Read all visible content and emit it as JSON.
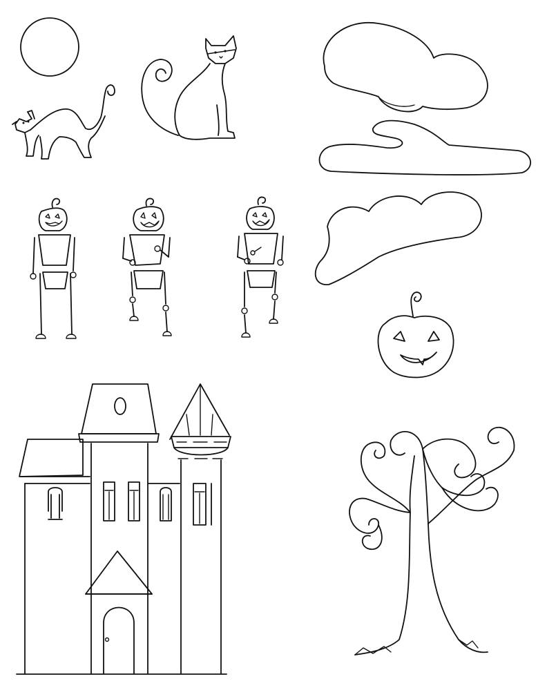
{
  "sheet": {
    "description_items": [
      "full-moon",
      "arched-black-cat",
      "sitting-cat",
      "puffy-cloud",
      "long-flat-cloud",
      "middle-cloud",
      "pumpkin-skeleton-standing",
      "pumpkin-skeleton-waving",
      "pumpkin-skeleton-dancing",
      "jack-o-lantern",
      "haunted-house",
      "spooky-tree"
    ],
    "ink_color": "#111111",
    "paper_color": "#ffffff"
  }
}
